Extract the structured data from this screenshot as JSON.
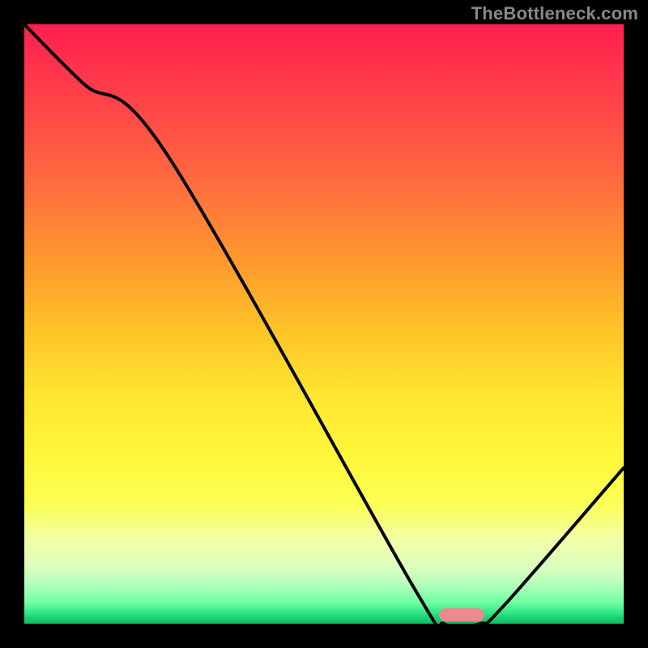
{
  "attribution": "TheBottleneck.com",
  "colors": {
    "frame": "#000000",
    "curve": "#000000",
    "marker": "#ea8a8f",
    "attribution_text": "#888888"
  },
  "chart_data": {
    "type": "line",
    "title": "",
    "xlabel": "",
    "ylabel": "",
    "xlim": [
      0,
      100
    ],
    "ylim": [
      0,
      100
    ],
    "series": [
      {
        "name": "curve",
        "x": [
          0,
          10,
          24,
          65,
          70,
          76,
          80,
          100
        ],
        "values": [
          100,
          90,
          78,
          6,
          0,
          0,
          3,
          26
        ]
      }
    ],
    "marker": {
      "x": 73,
      "y": 1.5,
      "shape": "pill"
    },
    "gradient_stops": [
      {
        "pos": 0.0,
        "color": "#ff1f4f"
      },
      {
        "pos": 0.1,
        "color": "#ff3a4a"
      },
      {
        "pos": 0.25,
        "color": "#ff6740"
      },
      {
        "pos": 0.4,
        "color": "#ff9a2e"
      },
      {
        "pos": 0.52,
        "color": "#ffc728"
      },
      {
        "pos": 0.62,
        "color": "#ffe631"
      },
      {
        "pos": 0.72,
        "color": "#fff73a"
      },
      {
        "pos": 0.8,
        "color": "#fbff55"
      },
      {
        "pos": 0.86,
        "color": "#f3ffa8"
      },
      {
        "pos": 0.91,
        "color": "#d8ffc0"
      },
      {
        "pos": 0.94,
        "color": "#a8ffb8"
      },
      {
        "pos": 0.965,
        "color": "#6effa0"
      },
      {
        "pos": 0.982,
        "color": "#30e686"
      },
      {
        "pos": 0.991,
        "color": "#18d070"
      },
      {
        "pos": 1.0,
        "color": "#0cc05f"
      }
    ]
  }
}
